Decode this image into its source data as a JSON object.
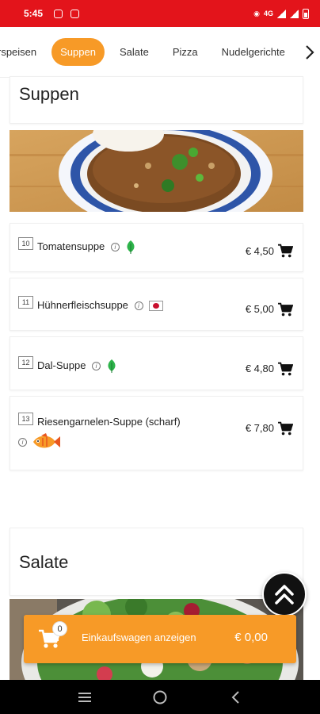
{
  "status": {
    "time": "5:45",
    "network": "4G"
  },
  "tabs": {
    "items": [
      {
        "label": "rspeisen"
      },
      {
        "label": "Suppen"
      },
      {
        "label": "Salate"
      },
      {
        "label": "Pizza"
      },
      {
        "label": "Nudelgerichte"
      }
    ],
    "active_index": 1
  },
  "sections": {
    "soups": {
      "title": "Suppen"
    },
    "salads": {
      "title": "Salate"
    }
  },
  "menu_items": [
    {
      "number": "10",
      "name": "Tomatensuppe",
      "price": "€ 4,50",
      "badge": "vegetarian-leaf-icon"
    },
    {
      "number": "11",
      "name": "Hühnerfleischsuppe",
      "price": "€ 5,00",
      "badge": "flag-icon"
    },
    {
      "number": "12",
      "name": "Dal-Suppe",
      "price": "€ 4,80",
      "badge": "vegetarian-leaf-icon"
    },
    {
      "number": "13",
      "name": "Riesengarnelen-Suppe (scharf)",
      "price": "€ 7,80",
      "badge": "fish-icon"
    }
  ],
  "cart": {
    "count": "0",
    "label": "Einkaufswagen anzeigen",
    "total": "€ 0,00"
  },
  "colors": {
    "status_bar": "#e3141b",
    "accent": "#f79a27",
    "nav_bar": "#000000"
  }
}
